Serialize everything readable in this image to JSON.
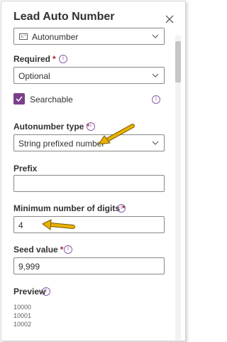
{
  "panel": {
    "title": "Lead Auto Number"
  },
  "data_type": {
    "value": "Autonumber"
  },
  "required": {
    "label": "Required",
    "asterisk": "*",
    "value": "Optional"
  },
  "searchable": {
    "label": "Searchable",
    "checked": true
  },
  "autonumber_type": {
    "label": "Autonumber type",
    "asterisk": "*",
    "value": "String prefixed number"
  },
  "prefix": {
    "label": "Prefix",
    "value": ""
  },
  "min_digits": {
    "label": "Minimum number of digits",
    "asterisk": "*",
    "value": "4"
  },
  "seed": {
    "label": "Seed value",
    "asterisk": "*",
    "value": "9,999"
  },
  "preview": {
    "label": "Preview",
    "lines": [
      "10000",
      "10001",
      "10002"
    ]
  },
  "colors": {
    "accent": "#7B3F8C",
    "required": "#A4262C",
    "arrow": "#E8B100"
  }
}
